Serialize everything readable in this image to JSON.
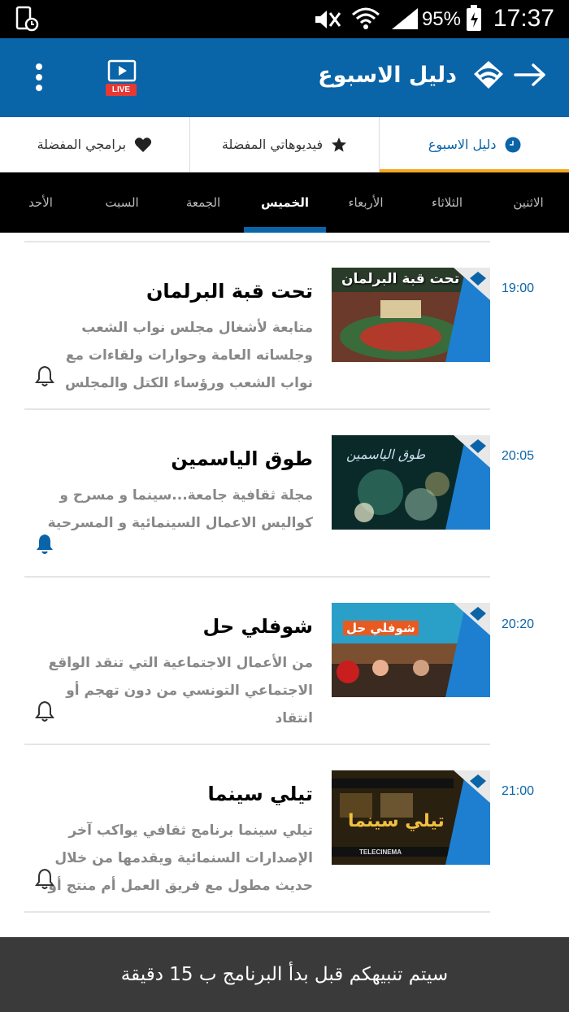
{
  "status_bar": {
    "battery_percent": "95%",
    "time": "17:37"
  },
  "app_bar": {
    "title": "دليل الاسبوع",
    "live_label": "LIVE"
  },
  "top_tabs": [
    {
      "label": "دليل الاسبوع",
      "icon": "clock-icon",
      "active": true
    },
    {
      "label": "فيديوهاتي المفضلة",
      "icon": "star-icon",
      "active": false
    },
    {
      "label": "برامجي المفضلة",
      "icon": "heart-icon",
      "active": false
    }
  ],
  "day_tabs": [
    {
      "label": "الاثنين"
    },
    {
      "label": "الثلاثاء"
    },
    {
      "label": "الأربعاء"
    },
    {
      "label": "الخميس",
      "active": true
    },
    {
      "label": "الجمعة"
    },
    {
      "label": "السبت"
    },
    {
      "label": "الأحد"
    }
  ],
  "programs": [
    {
      "time": "19:00",
      "title": "تحت قبة البرلمان",
      "description": "متابعة لأشغال مجلس نواب الشعب وجلساته العامة وحوارات ولقاءات مع نواب الشعب ورؤساء الكتل والمجلس",
      "thumb_text": "تحت قبة البرلمان",
      "alert_on": false
    },
    {
      "time": "20:05",
      "title": "طوق الياسمين",
      "description": "مجلة ثقافية جامعة...سينما و مسرح و كواليس الاعمال السينمائية و المسرحية",
      "thumb_text": "طوق الياسمين",
      "alert_on": true
    },
    {
      "time": "20:20",
      "title": "شوفلي حل",
      "description": "من الأعمال الاجتماعية التي تنقد الواقع الاجتماعي التونسي من دون تهجم أو انتقاد",
      "thumb_text": "شوفلي حل",
      "alert_on": false
    },
    {
      "time": "21:00",
      "title": "تيلي سينما",
      "description": "تيلي سينما برنامج ثقافي يواكب آخر الإصدارات السنمائية ويقدمها من خلال حديث مطول مع فريق العمل أم منتج أو",
      "thumb_text": "تيلي سينما",
      "thumb_subtext": "TELECINEMA",
      "alert_on": false
    }
  ],
  "toast": {
    "message": "سيتم تنبيهكم قبل بدأ البرنامج ب 15 دقيقة"
  },
  "colors": {
    "primary": "#0a64a8",
    "accent": "#f4a81d",
    "live_red": "#e53935"
  }
}
